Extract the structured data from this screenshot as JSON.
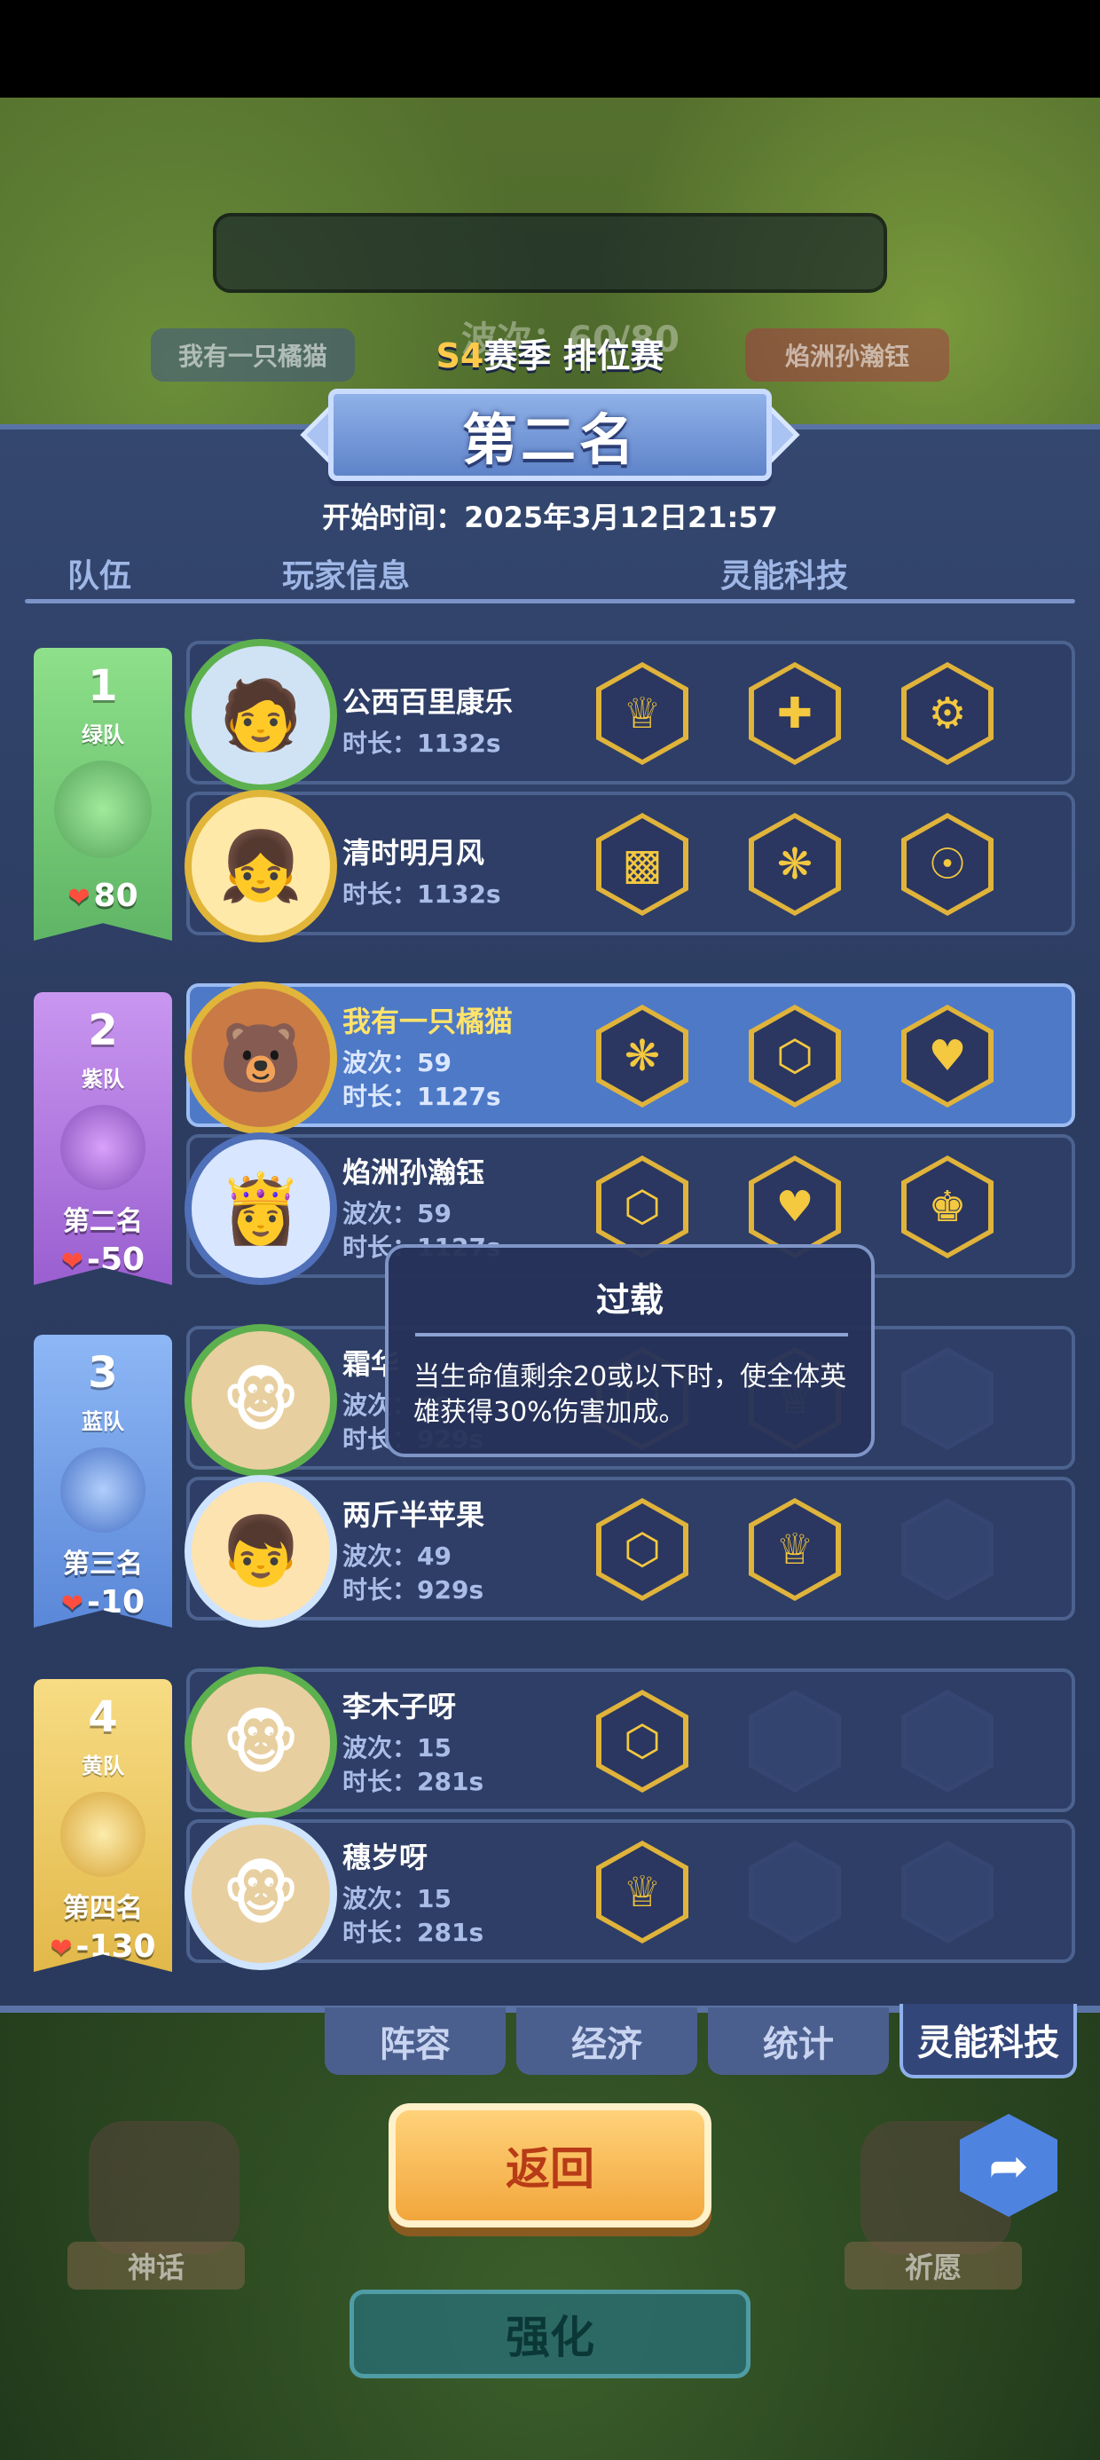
{
  "season": {
    "prefix": "S4",
    "label": "赛季 排位赛"
  },
  "rank_title": "第二名",
  "start_time": "开始时间：2025年3月12日21:57",
  "background": {
    "wave": "波次：60/80",
    "left_name": "我有一只橘猫",
    "right_name": "焰洲孙瀚钰"
  },
  "headers": {
    "team": "队伍",
    "player": "玩家信息",
    "tech": "灵能科技"
  },
  "teams": [
    {
      "num": "1",
      "name": "绿队",
      "place": "",
      "score": "80",
      "color": "#7fd07a",
      "dark": "#4f9d55"
    },
    {
      "num": "2",
      "name": "紫队",
      "place": "第二名",
      "score": "-50",
      "color": "#b77de6",
      "dark": "#7e47b4"
    },
    {
      "num": "3",
      "name": "蓝队",
      "place": "第三名",
      "score": "-10",
      "color": "#79a6ef",
      "dark": "#4a72c4"
    },
    {
      "num": "4",
      "name": "黄队",
      "place": "第四名",
      "score": "-130",
      "color": "#f2cf63",
      "dark": "#c79a2e"
    }
  ],
  "players": [
    {
      "name": "公西百里康乐",
      "wave": "",
      "duration": "时长：1132s",
      "techs": [
        "crown-tech",
        "medic-tech",
        "gear-tech"
      ]
    },
    {
      "name": "清时明月风",
      "wave": "",
      "duration": "时长：1132s",
      "techs": [
        "gold-tech",
        "swirl-tech",
        "orbit-tech"
      ]
    },
    {
      "name": "我有一只橘猫",
      "wave": "波次：59",
      "duration": "时长：1127s",
      "techs": [
        "swirl-tech",
        "shield-tech",
        "heart-tech"
      ]
    },
    {
      "name": "焰洲孙瀚钰",
      "wave": "波次：59",
      "duration": "时长：1127s",
      "techs": [
        "shield-tech",
        "heart-tech",
        "chess-tech"
      ]
    },
    {
      "name": "霜华",
      "wave": "波次：49",
      "duration": "时长：929s",
      "techs": [
        "shield-tech",
        "crown-tech",
        ""
      ]
    },
    {
      "name": "两斤半苹果",
      "wave": "波次：49",
      "duration": "时长：929s",
      "techs": [
        "shield-tech",
        "crown-tech",
        ""
      ]
    },
    {
      "name": "李木子呀",
      "wave": "波次：15",
      "duration": "时长：281s",
      "techs": [
        "shield-tech",
        "",
        ""
      ]
    },
    {
      "name": "穗岁呀",
      "wave": "波次：15",
      "duration": "时长：281s",
      "techs": [
        "crown-tech",
        "",
        ""
      ]
    }
  ],
  "tooltip": {
    "title": "过载",
    "desc": "当生命值剩余20或以下时，使全体英雄获得30%伤害加成。"
  },
  "tabs": [
    "阵容",
    "经济",
    "统计",
    "灵能科技"
  ],
  "active_tab": "灵能科技",
  "buttons": {
    "back": "返回",
    "enhance": "强化",
    "myth": "神话",
    "wish": "祈愿"
  }
}
